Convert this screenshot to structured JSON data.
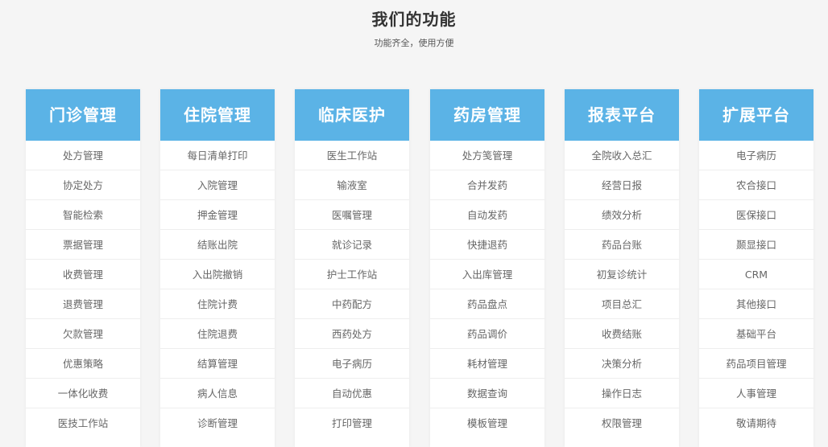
{
  "header": {
    "title": "我们的功能",
    "subtitle": "功能齐全，使用方便"
  },
  "columns": [
    {
      "title": "门诊管理",
      "items": [
        "处方管理",
        "协定处方",
        "智能检索",
        "票据管理",
        "收费管理",
        "退费管理",
        "欠款管理",
        "优惠策略",
        "一体化收费",
        "医技工作站"
      ]
    },
    {
      "title": "住院管理",
      "items": [
        "每日清单打印",
        "入院管理",
        "押金管理",
        "结账出院",
        "入出院撤销",
        "住院计费",
        "住院退费",
        "结算管理",
        "病人信息",
        "诊断管理"
      ]
    },
    {
      "title": "临床医护",
      "items": [
        "医生工作站",
        "输液室",
        "医嘱管理",
        "就诊记录",
        "护士工作站",
        "中药配方",
        "西药处方",
        "电子病历",
        "自动优惠",
        "打印管理"
      ]
    },
    {
      "title": "药房管理",
      "items": [
        "处方笺管理",
        "合并发药",
        "自动发药",
        "快捷退药",
        "入出库管理",
        "药品盘点",
        "药品调价",
        "耗材管理",
        "数据查询",
        "模板管理"
      ]
    },
    {
      "title": "报表平台",
      "items": [
        "全院收入总汇",
        "经营日报",
        "绩效分析",
        "药品台账",
        "初复诊统计",
        "项目总汇",
        "收费结账",
        "决策分析",
        "操作日志",
        "权限管理"
      ]
    },
    {
      "title": "扩展平台",
      "items": [
        "电子病历",
        "农合接口",
        "医保接口",
        "颞显接口",
        "CRM",
        "其他接口",
        "基础平台",
        "药品项目管理",
        "人事管理",
        "敬请期待"
      ]
    }
  ]
}
